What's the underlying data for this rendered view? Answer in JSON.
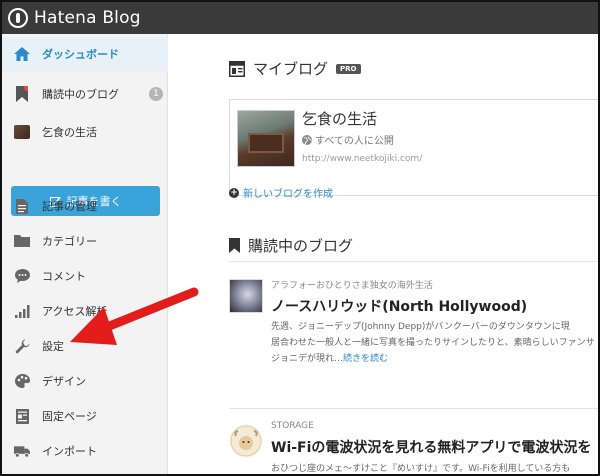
{
  "header": {
    "logo_text": "Hatena Blog"
  },
  "sidebar": {
    "items": [
      {
        "label": "ダッシュボード",
        "icon": "home-icon"
      },
      {
        "label": "購読中のブログ",
        "icon": "bookmark-icon",
        "badge": "1"
      },
      {
        "label": "乞食の生活",
        "icon": "blog-thumbnail-icon"
      },
      {
        "label": "記事の管理",
        "icon": "document-icon"
      },
      {
        "label": "カテゴリー",
        "icon": "folder-icon"
      },
      {
        "label": "コメント",
        "icon": "comment-icon"
      },
      {
        "label": "アクセス解析",
        "icon": "bar-chart-icon"
      },
      {
        "label": "設定",
        "icon": "wrench-icon"
      },
      {
        "label": "デザイン",
        "icon": "palette-icon"
      },
      {
        "label": "固定ページ",
        "icon": "page-icon"
      },
      {
        "label": "インポート",
        "icon": "truck-icon"
      }
    ],
    "write_button": "記事を書く"
  },
  "myblog": {
    "title": "マイブログ",
    "badge": "PRO",
    "blog_name": "乞食の生活",
    "visibility": "すべての人に公開",
    "url": "http://www.neetkojiki.com/",
    "new_blog_link": "新しいブログを作成"
  },
  "subscribed": {
    "title": "購読中のブログ",
    "entries": [
      {
        "category": "アラフォーおひとりさま独女の海外生活",
        "title": "ノースハリウッド(North Hollywood)",
        "body_lines": [
          "先週、ジョニーデップ(Johnny Depp)がバンクーバーのダウンタウンに現",
          "居合わせた一般人と一緒に写真を撮ったりサインしたりと、素晴らしいファンサ",
          "ジョニデが現れ…"
        ],
        "read_more": "続きを読む"
      },
      {
        "category": "STORAGE",
        "title": "Wi-Fiの電波状況を見れる無料アプリで電波状況を",
        "body_lines": [
          "おひつじ座のメェ〜すけこと『めいすけ』です。Wi-Fiを利用している方も"
        ]
      }
    ]
  },
  "colors": {
    "accent": "#3aa3d9",
    "topbar": "#3a3a3a",
    "arrow": "#e31c1c"
  }
}
